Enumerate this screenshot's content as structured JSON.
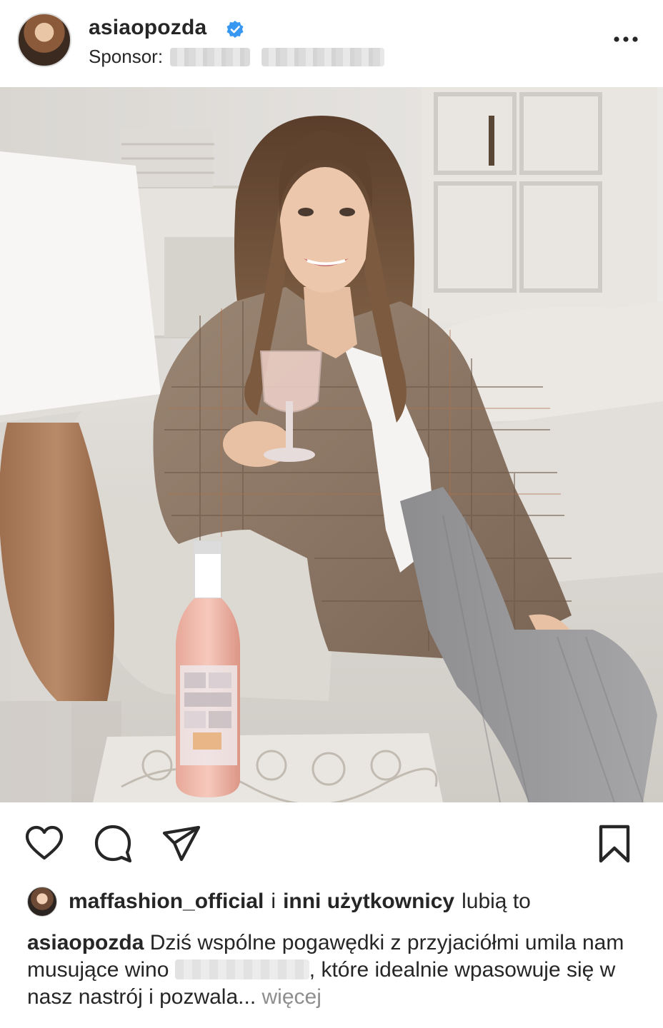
{
  "post": {
    "username": "asiaopozda",
    "sponsor_label": "Sponsor:",
    "icons": {
      "verified": "verified-badge-icon",
      "more": "more-options-icon",
      "like": "heart-icon",
      "comment": "comment-icon",
      "share": "send-icon",
      "save": "bookmark-icon"
    },
    "colors": {
      "verified": "#3897f0",
      "text": "#262626",
      "muted": "#8e8e8e"
    }
  },
  "likes": {
    "liker": "maffashion_official",
    "connector": "i",
    "others": "inni użytkownicy",
    "suffix": "lubią to"
  },
  "caption": {
    "username": "asiaopozda",
    "text_before": "Dziś wspólne pogawędki z przyjaciółmi umila nam musujące wino",
    "text_after": ", które idealnie wpasowuje się w nasz nastrój i pozwala...",
    "more": "więcej"
  }
}
